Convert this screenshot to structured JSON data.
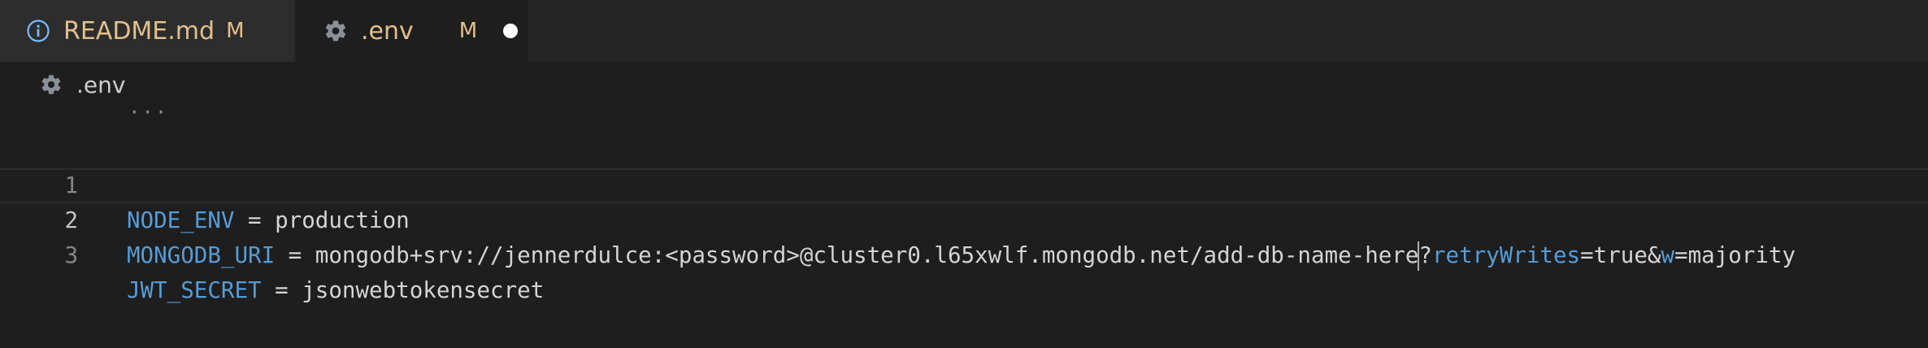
{
  "tabs": [
    {
      "label": "README.md",
      "status": "M",
      "icon": "info-icon",
      "active": false
    },
    {
      "label": ".env",
      "status": "M",
      "icon": "gear-icon",
      "active": true,
      "dirty": true
    }
  ],
  "breadcrumb": {
    "icon": "gear-icon",
    "label": ".env"
  },
  "fold_ellipsis": "···",
  "editor": {
    "lines": [
      {
        "number": "1",
        "key": "NODE_ENV",
        "op": " = ",
        "value": "production"
      },
      {
        "number": "2",
        "key": "MONGODB_URI",
        "op": " = ",
        "value_head": "mongodb+srv://jennerdulce:<password>@cluster0.l65xwlf.mongodb.net/add-db-name-here",
        "value_tail": "?",
        "param1_key": "retryWrites",
        "param1_rest": "=true&",
        "param2_key": "w",
        "param2_rest": "=majority"
      },
      {
        "number": "3",
        "key": "JWT_SECRET",
        "op": " = ",
        "value": "jsonwebtokensecret"
      }
    ],
    "current_line": "2"
  },
  "colors": {
    "background": "#1e1e1e",
    "tabbar": "#252526",
    "modified": "#e2c08d",
    "key": "#569cd6",
    "text": "#d4d4d4"
  }
}
